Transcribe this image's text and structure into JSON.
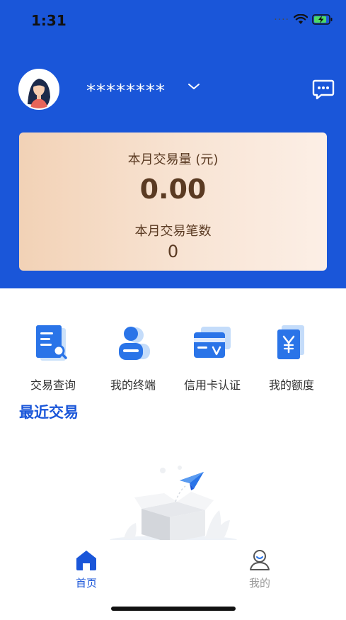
{
  "status_bar": {
    "time": "1:31",
    "icons": [
      "signal-dots-icon",
      "wifi-icon",
      "battery-charging-icon"
    ]
  },
  "profile": {
    "account_masked": "********",
    "avatar_icon": "avatar-woman-icon",
    "message_icon": "message-bubble-icon"
  },
  "summary_card": {
    "month_volume_label": "本月交易量 (元)",
    "month_volume_value": "0.00",
    "month_count_label": "本月交易笔数",
    "month_count_value": "0"
  },
  "shortcuts": [
    {
      "label": "交易查询",
      "icon": "transaction-query-icon"
    },
    {
      "label": "我的终端",
      "icon": "terminal-user-icon"
    },
    {
      "label": "信用卡认证",
      "icon": "credit-card-verify-icon"
    },
    {
      "label": "我的额度",
      "icon": "quota-yen-icon"
    }
  ],
  "recent": {
    "title": "最近交易",
    "empty_illustration": "empty-box-paper-plane-icon"
  },
  "tabbar": {
    "home_label": "首页",
    "mine_label": "我的",
    "active_color": "#1a56d9",
    "inactive_color": "#999999"
  },
  "colors": {
    "brand_blue": "#1a56d9",
    "card_brown_text": "#5a3a22"
  }
}
